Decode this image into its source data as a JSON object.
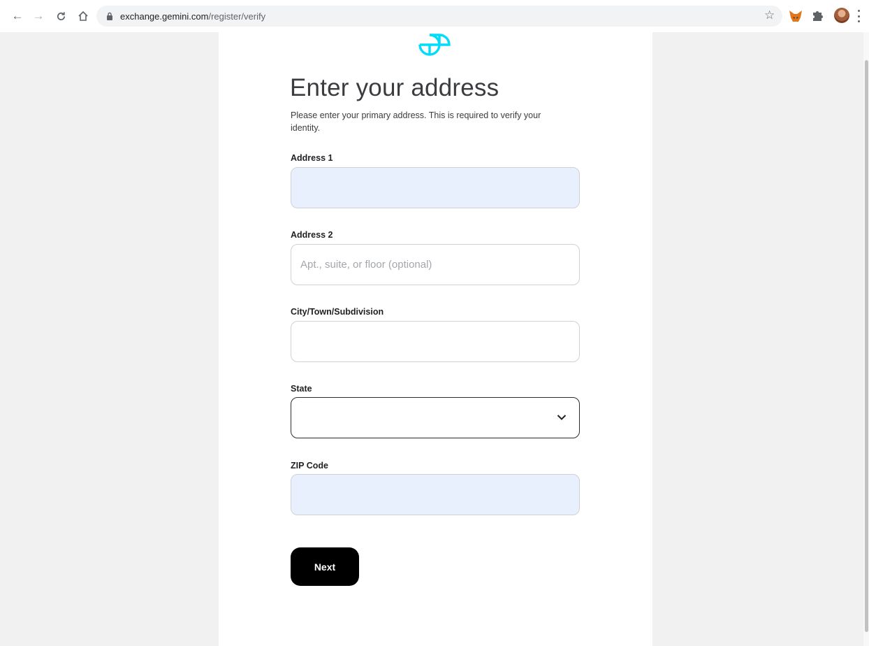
{
  "browser": {
    "url_host": "exchange.gemini.com",
    "url_path": "/register/verify"
  },
  "page": {
    "title": "Enter your address",
    "subtitle": "Please enter your primary address. This is required to verify your identity."
  },
  "form": {
    "address1": {
      "label": "Address 1",
      "value": "",
      "placeholder": ""
    },
    "address2": {
      "label": "Address 2",
      "value": "",
      "placeholder": "Apt., suite, or floor (optional)"
    },
    "city": {
      "label": "City/Town/Subdivision",
      "value": "",
      "placeholder": ""
    },
    "state": {
      "label": "State",
      "value": ""
    },
    "zip": {
      "label": "ZIP Code",
      "value": "",
      "placeholder": ""
    }
  },
  "actions": {
    "next_label": "Next"
  },
  "colors": {
    "brand": "#00dcfa",
    "button": "#000000",
    "autofill": "#e8f0fe"
  }
}
